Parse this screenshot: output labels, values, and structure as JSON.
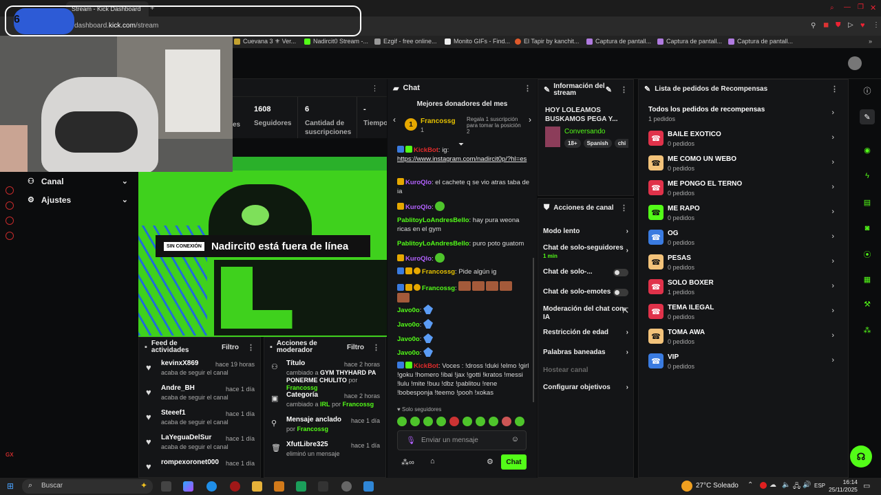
{
  "browser": {
    "tab_title": "Stream - Kick Dashboard",
    "url_domain": "kick.com",
    "url_prefix": "dashboard.",
    "url_path": "/stream",
    "bookmarks": [
      "Cuevana 3 ⚜ Ver...",
      "Nadircit0 Stream -...",
      "Ezgif - free online...",
      "Monito GIFs - Find...",
      "El Tapir by kanchit...",
      "Captura de pantall...",
      "Captura de pantall...",
      "Captura de pantall..."
    ]
  },
  "overlay": {
    "counter": "6"
  },
  "sidebar": {
    "items": [
      {
        "label": "Canal",
        "icon": "users-icon"
      },
      {
        "label": "Ajustes",
        "icon": "gear-icon"
      }
    ]
  },
  "stats": {
    "items": [
      {
        "value": "",
        "label": "es"
      },
      {
        "value": "1608",
        "label": "Seguidores"
      },
      {
        "value": "6",
        "label": "Cantidad de suscripciones"
      },
      {
        "value": "-",
        "label": "Tiempo en vivo"
      }
    ]
  },
  "offline": {
    "badge": "SIN CONEXIÓN",
    "title": "Nadircit0 está fuera de línea"
  },
  "feed": {
    "title": "Feed de actividades",
    "filter": "Filtro",
    "items": [
      {
        "name": "kevinxX869",
        "action": "acaba de seguir el canal",
        "time": "hace 19 horas"
      },
      {
        "name": "Andre_BH",
        "action": "acaba de seguir el canal",
        "time": "hace 1 día"
      },
      {
        "name": "Steeef1",
        "action": "acaba de seguir el canal",
        "time": "hace 1 día"
      },
      {
        "name": "LaYeguaDelSur",
        "action": "acaba de seguir el canal",
        "time": "hace 1 día"
      },
      {
        "name": "rompexoronet000",
        "action": "",
        "time": "hace 1 día"
      }
    ]
  },
  "mod": {
    "title": "Acciones de moderador",
    "filter": "Filtro",
    "items": [
      {
        "name": "Título",
        "detail_prefix": "cambiado a",
        "detail": "GYM THYHARD PA PONERME CHULITO",
        "by": "por",
        "user": "Francossg",
        "time": "hace 2 horas",
        "icon": "text-icon"
      },
      {
        "name": "Categoría",
        "detail_prefix": "cambiado a",
        "detail": "IRL",
        "by": "por",
        "user": "Francossg",
        "time": "hace 2 horas",
        "icon": "category-icon"
      },
      {
        "name": "Mensaje anclado",
        "detail_prefix": "por",
        "detail": "",
        "by": "",
        "user": "Francossg",
        "time": "hace 1 día",
        "icon": "pin-icon"
      },
      {
        "name": "XfutLibre325",
        "detail_prefix": "eliminó un mensaje",
        "detail": "",
        "by": "",
        "user": "",
        "time": "hace 1 día",
        "icon": "trash-icon"
      }
    ]
  },
  "chat": {
    "title": "Chat",
    "donors_title": "Mejores donadores del mes",
    "donor_name": "Francossg",
    "donor_rank": "1",
    "donor_count": "1",
    "donor_note": "Regala 1 suscripción para tomar la posición 2",
    "messages": [
      {
        "user": "KickBot",
        "text": "ig:"
      },
      {
        "user": "",
        "text": "https://www.instagram.com/nadircit0p/?hl=es"
      },
      {
        "user": "KuroQlo",
        "text": "el cachete q se vio atras taba de ia"
      },
      {
        "user": "KuroQlo",
        "text": ""
      },
      {
        "user": "PablitoyLoAndresBello",
        "text": "hay pura weona ricas en el gym"
      },
      {
        "user": "PablitoyLoAndresBello",
        "text": "puro poto guatom"
      },
      {
        "user": "KuroQlo",
        "text": ""
      },
      {
        "user": "Francossg",
        "text": "Pide algún ig"
      },
      {
        "user": "Francossg",
        "text": ""
      },
      {
        "user": "Javo0o",
        "text": ""
      },
      {
        "user": "Javo0o",
        "text": ""
      },
      {
        "user": "Javo0o",
        "text": ""
      },
      {
        "user": "Javo0o",
        "text": ""
      },
      {
        "user": "KickBot",
        "text": "Voces : !dross !duki !elmo !girl !goku !homero !ibai !jax !gotti !kratos !messi !lulu !mite !buu !dbz !pablitou !rene !bobesponja !teemo !pooh !xokas"
      }
    ],
    "followers_only": "Solo seguidores",
    "input_placeholder": "Enviar un mensaje",
    "send_label": "Chat"
  },
  "info": {
    "title": "Información del stream",
    "stream_title": "HOY LOLEAMOS BUSKAMOS PEGA Y...",
    "category": "Conversando",
    "tags": [
      "18+",
      "Spanish",
      "chi"
    ]
  },
  "actions": {
    "title": "Acciones de canal",
    "items": [
      {
        "label": "Modo lento",
        "sub": "",
        "control": "chevron"
      },
      {
        "label": "Chat de solo-seguidores",
        "sub": "1 min",
        "control": "chevron"
      },
      {
        "label": "Chat de solo-...",
        "sub": "",
        "control": "toggle"
      },
      {
        "label": "Chat de solo-emotes",
        "sub": "",
        "control": "toggle"
      },
      {
        "label": "Moderación del chat con IA",
        "sub": "",
        "control": "external"
      },
      {
        "label": "Restricción de edad",
        "sub": "",
        "control": "chevron"
      },
      {
        "label": "Palabras baneadas",
        "sub": "",
        "control": "chevron"
      },
      {
        "label": "Hostear canal",
        "sub": "",
        "control": "disabled"
      },
      {
        "label": "Configurar objetivos",
        "sub": "",
        "control": "chevron"
      }
    ]
  },
  "rewards": {
    "title": "Lista de pedidos de Recompensas",
    "all_title": "Todos los pedidos de recompensas",
    "all_count": "1 pedidos",
    "items": [
      {
        "title": "BAILE EXOTICO",
        "count": "0 pedidos",
        "color": "#e0324a"
      },
      {
        "title": "ME COMO UN WEBO",
        "count": "0 pedidos",
        "color": "#f2c27a"
      },
      {
        "title": "ME PONGO EL TERNO",
        "count": "0 pedidos",
        "color": "#e0324a"
      },
      {
        "title": "ME RAPO",
        "count": "0 pedidos",
        "color": "#53fc18"
      },
      {
        "title": "OG",
        "count": "0 pedidos",
        "color": "#3a7be0"
      },
      {
        "title": "PESAS",
        "count": "0 pedidos",
        "color": "#f2c27a"
      },
      {
        "title": "SOLO BOXER",
        "count": "1 pedidos",
        "color": "#e0324a"
      },
      {
        "title": "TEMA ILEGAL",
        "count": "0 pedidos",
        "color": "#e0324a"
      },
      {
        "title": "TOMA AWA",
        "count": "0 pedidos",
        "color": "#f2c27a"
      },
      {
        "title": "VIP",
        "count": "0 pedidos",
        "color": "#3a7be0"
      }
    ]
  },
  "taskbar": {
    "search": "Buscar",
    "weather": "27°C Soleado",
    "lang": "ESP",
    "time": "16:14",
    "date": "25/11/2025"
  }
}
